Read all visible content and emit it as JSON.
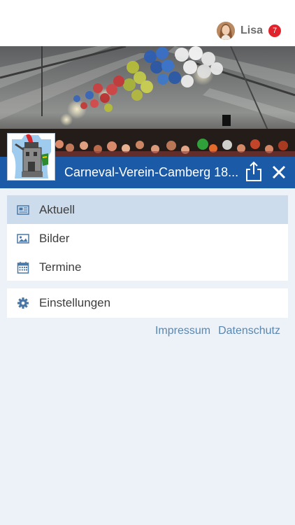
{
  "user": {
    "name": "Lisa",
    "badge_count": "7"
  },
  "club": {
    "title": "Carneval-Verein-Camberg 18..."
  },
  "menu": [
    {
      "label": "Aktuell",
      "icon": "newspaper-icon",
      "active": true
    },
    {
      "label": "Bilder",
      "icon": "image-icon",
      "active": false
    },
    {
      "label": "Termine",
      "icon": "calendar-icon",
      "active": false
    }
  ],
  "settings": {
    "label": "Einstellungen",
    "icon": "gear-icon"
  },
  "links": {
    "impressum": "Impressum",
    "datenschutz": "Datenschutz"
  },
  "colors": {
    "brand_blue": "#1b5aa6",
    "icon_blue": "#4a78a6",
    "active_row": "#cddcec",
    "badge_red": "#e3232b",
    "link": "#5a87ae",
    "background": "#edf2f9"
  }
}
